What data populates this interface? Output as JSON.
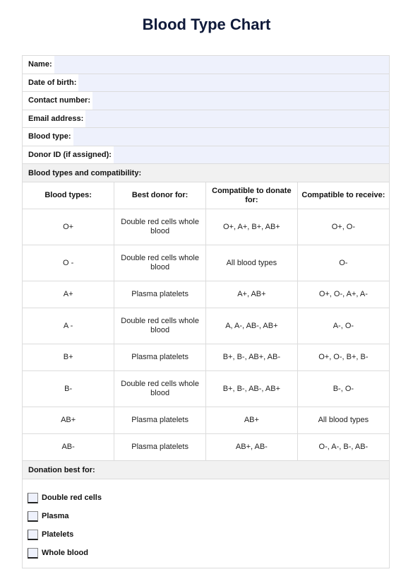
{
  "title": "Blood Type Chart",
  "fields": [
    {
      "label": "Name:",
      "value": ""
    },
    {
      "label": "Date of birth:",
      "value": ""
    },
    {
      "label": "Contact number:",
      "value": ""
    },
    {
      "label": "Email address:",
      "value": ""
    },
    {
      "label": "Blood type:",
      "value": ""
    },
    {
      "label": "Donor ID (if assigned):",
      "value": ""
    }
  ],
  "compatibility": {
    "section_label": "Blood types and compatibility:",
    "headers": [
      "Blood types:",
      "Best donor for:",
      "Compatible to donate for:",
      "Compatible to receive:"
    ],
    "rows": [
      {
        "type": "O+",
        "best_donor_for": "Double red cells whole blood",
        "donate_to": "O+, A+, B+, AB+",
        "receive_from": "O+, O-"
      },
      {
        "type": "O -",
        "best_donor_for": "Double red cells whole blood",
        "donate_to": "All blood types",
        "receive_from": "O-"
      },
      {
        "type": "A+",
        "best_donor_for": "Plasma platelets",
        "donate_to": "A+, AB+",
        "receive_from": "O+, O-, A+, A-"
      },
      {
        "type": "A -",
        "best_donor_for": "Double red cells whole blood",
        "donate_to": "A, A-, AB-, AB+",
        "receive_from": "A-, O-"
      },
      {
        "type": "B+",
        "best_donor_for": "Plasma platelets",
        "donate_to": "B+, B-, AB+, AB-",
        "receive_from": "O+, O-, B+, B-"
      },
      {
        "type": "B-",
        "best_donor_for": "Double red cells whole blood",
        "donate_to": "B+, B-, AB-, AB+",
        "receive_from": "B-, O-"
      },
      {
        "type": "AB+",
        "best_donor_for": "Plasma platelets",
        "donate_to": "AB+",
        "receive_from": "All blood types"
      },
      {
        "type": "AB-",
        "best_donor_for": "Plasma platelets",
        "donate_to": "AB+, AB-",
        "receive_from": "O-, A-, B-, AB-"
      }
    ]
  },
  "donation": {
    "section_label": "Donation best for:",
    "options": [
      {
        "label": "Double red cells",
        "checked": false
      },
      {
        "label": "Plasma",
        "checked": false
      },
      {
        "label": "Platelets",
        "checked": false
      },
      {
        "label": "Whole blood",
        "checked": false
      }
    ]
  }
}
